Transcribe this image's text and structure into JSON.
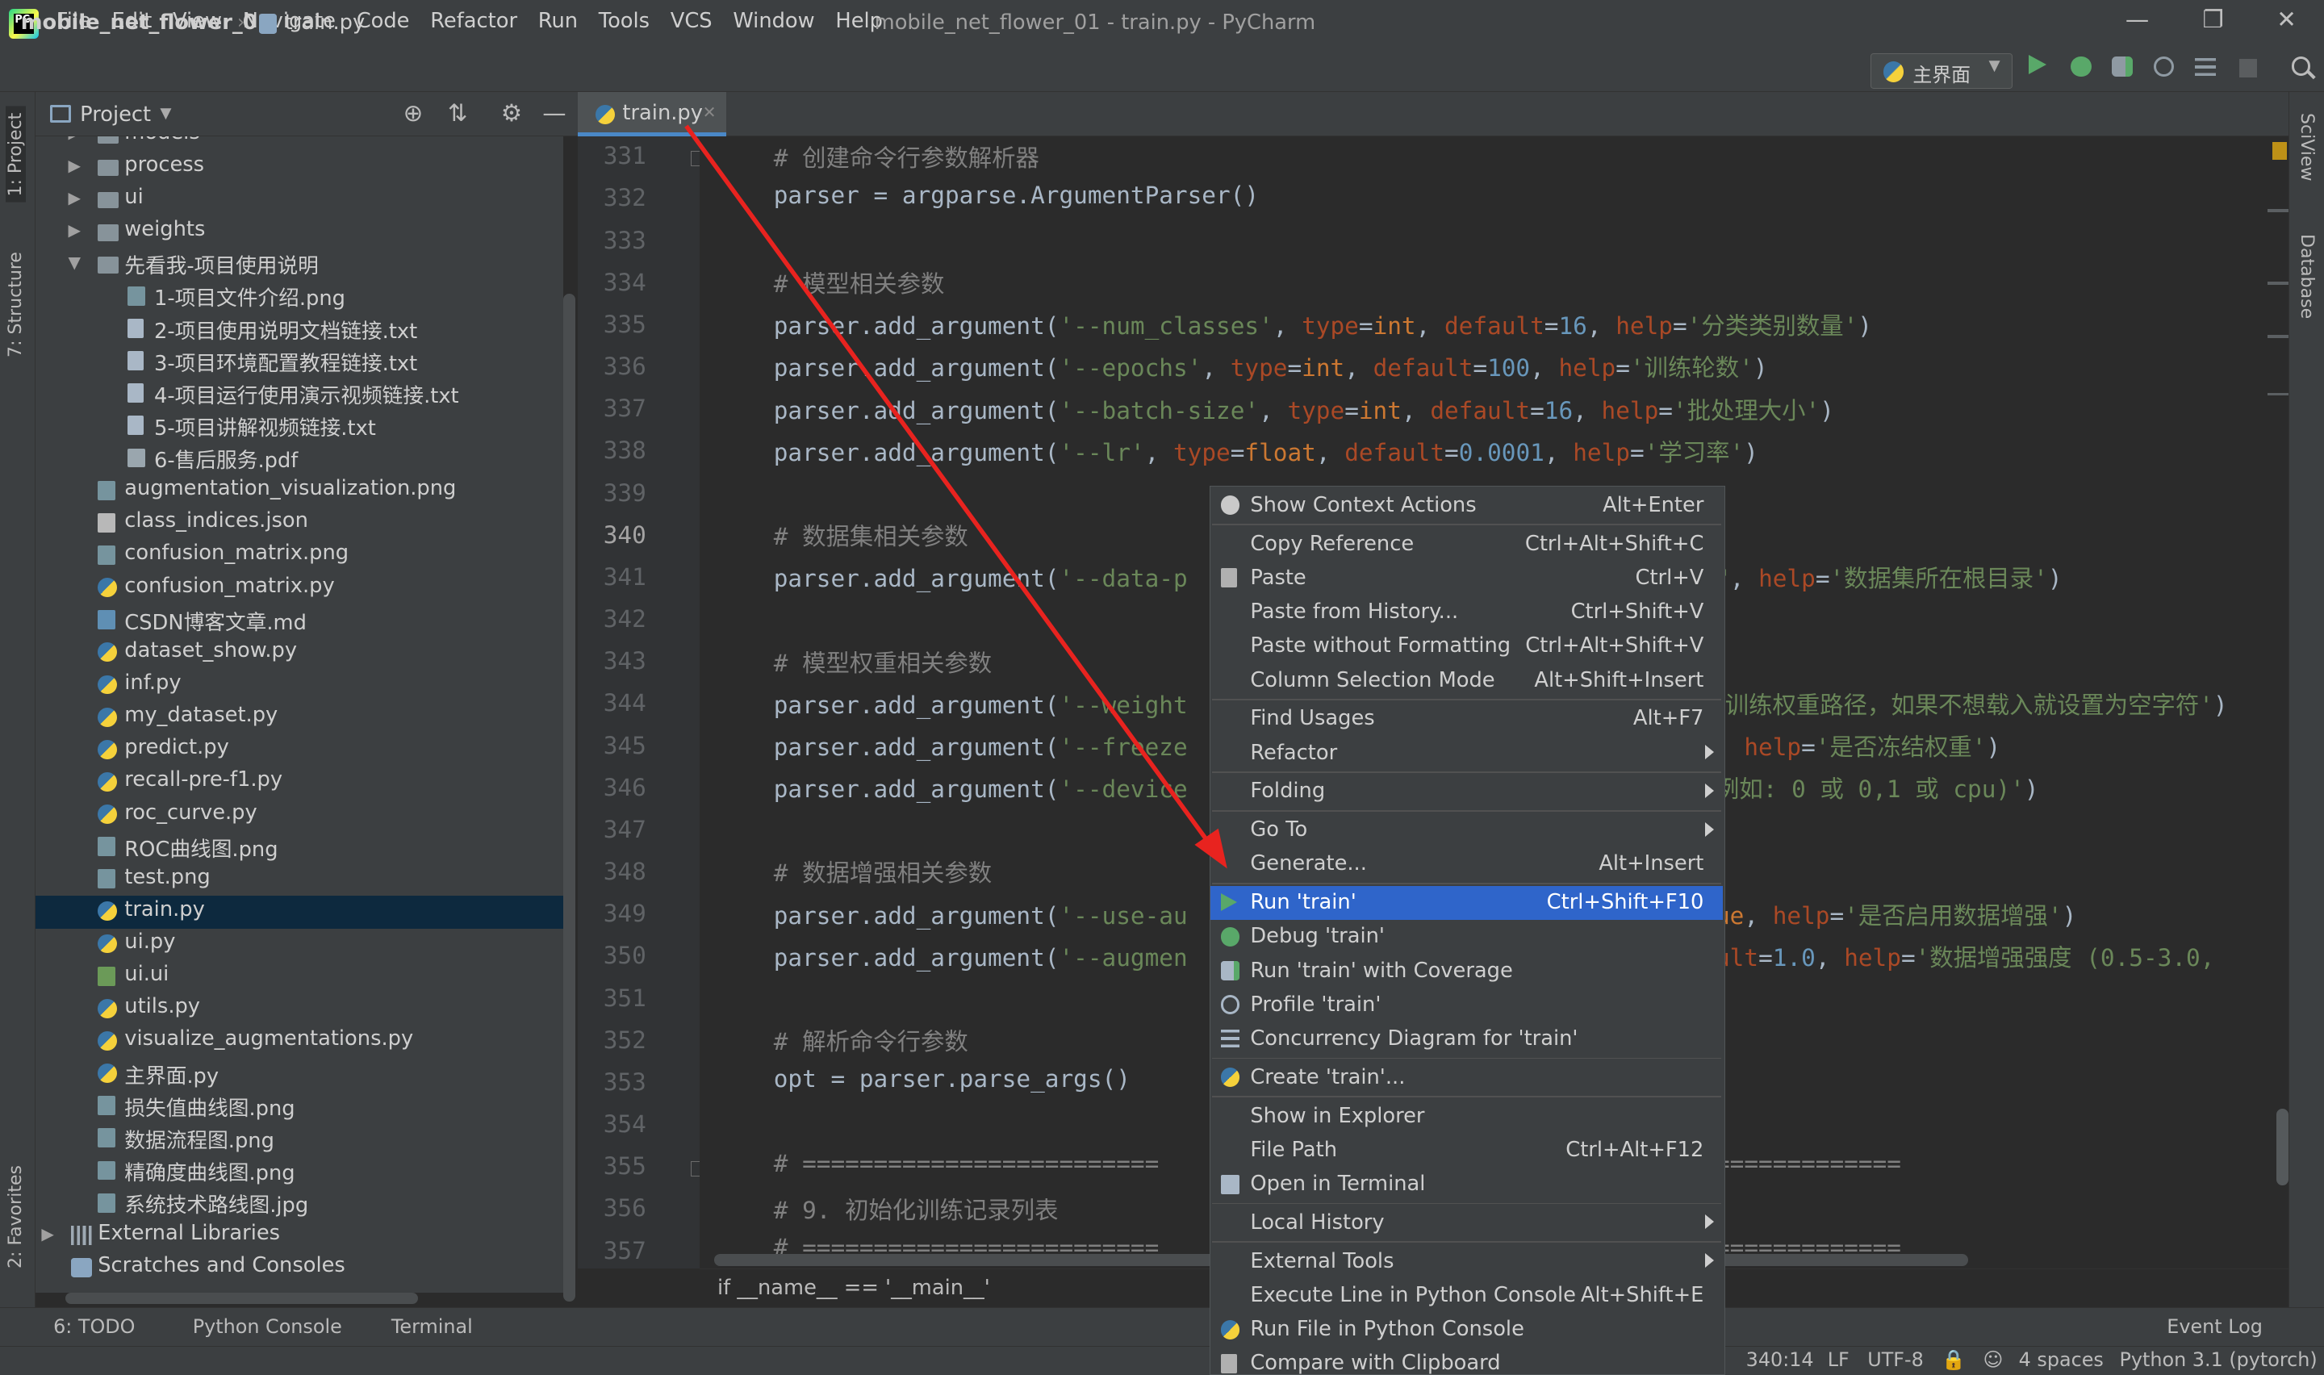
{
  "window": {
    "title": "mobile_net_flower_01 - train.py - PyCharm",
    "menu": [
      "File",
      "Edit",
      "View",
      "Navigate",
      "Code",
      "Refactor",
      "Run",
      "Tools",
      "VCS",
      "Window",
      "Help"
    ],
    "controls": {
      "minimize": "—",
      "restore": "❐",
      "close": "✕"
    }
  },
  "navbar": {
    "project": "mobile_net_flower_01",
    "file": "train.py",
    "run_config": "主界面"
  },
  "project_panel": {
    "title": "Project",
    "items": [
      {
        "label": "models",
        "type": "folder",
        "depth": 1,
        "collapsed": true
      },
      {
        "label": "process",
        "type": "folder",
        "depth": 1,
        "collapsed": true
      },
      {
        "label": "ui",
        "type": "folder",
        "depth": 1,
        "collapsed": true
      },
      {
        "label": "weights",
        "type": "folder",
        "depth": 1,
        "collapsed": true
      },
      {
        "label": "先看我-项目使用说明",
        "type": "folder",
        "depth": 1,
        "expanded": true
      },
      {
        "label": "1-项目文件介绍.png",
        "type": "img",
        "depth": 2
      },
      {
        "label": "2-项目使用说明文档链接.txt",
        "type": "file",
        "depth": 2
      },
      {
        "label": "3-项目环境配置教程链接.txt",
        "type": "file",
        "depth": 2
      },
      {
        "label": "4-项目运行使用演示视频链接.txt",
        "type": "file",
        "depth": 2
      },
      {
        "label": "5-项目讲解视频链接.txt",
        "type": "file",
        "depth": 2
      },
      {
        "label": "6-售后服务.pdf",
        "type": "pdf",
        "depth": 2
      },
      {
        "label": "augmentation_visualization.png",
        "type": "img",
        "depth": 1
      },
      {
        "label": "class_indices.json",
        "type": "json",
        "depth": 1
      },
      {
        "label": "confusion_matrix.png",
        "type": "img",
        "depth": 1
      },
      {
        "label": "confusion_matrix.py",
        "type": "py",
        "depth": 1
      },
      {
        "label": "CSDN博客文章.md",
        "type": "md",
        "depth": 1
      },
      {
        "label": "dataset_show.py",
        "type": "py",
        "depth": 1
      },
      {
        "label": "inf.py",
        "type": "py",
        "depth": 1
      },
      {
        "label": "my_dataset.py",
        "type": "py",
        "depth": 1
      },
      {
        "label": "predict.py",
        "type": "py",
        "depth": 1
      },
      {
        "label": "recall-pre-f1.py",
        "type": "py",
        "depth": 1
      },
      {
        "label": "roc_curve.py",
        "type": "py",
        "depth": 1
      },
      {
        "label": "ROC曲线图.png",
        "type": "img",
        "depth": 1
      },
      {
        "label": "test.png",
        "type": "img",
        "depth": 1
      },
      {
        "label": "train.py",
        "type": "py",
        "depth": 1,
        "selected": true
      },
      {
        "label": "ui.py",
        "type": "py",
        "depth": 1
      },
      {
        "label": "ui.ui",
        "type": "ui",
        "depth": 1
      },
      {
        "label": "utils.py",
        "type": "py",
        "depth": 1
      },
      {
        "label": "visualize_augmentations.py",
        "type": "py",
        "depth": 1
      },
      {
        "label": "主界面.py",
        "type": "py",
        "depth": 1
      },
      {
        "label": "损失值曲线图.png",
        "type": "img",
        "depth": 1
      },
      {
        "label": "数据流程图.png",
        "type": "img",
        "depth": 1
      },
      {
        "label": "精确度曲线图.png",
        "type": "img",
        "depth": 1
      },
      {
        "label": "系统技术路线图.jpg",
        "type": "img",
        "depth": 1
      },
      {
        "label": "External Libraries",
        "type": "lib",
        "depth": 0,
        "collapsed": true
      },
      {
        "label": "Scratches and Consoles",
        "type": "scratch",
        "depth": 0
      }
    ]
  },
  "left_stripe": {
    "project": "1: Project",
    "structure": "7: Structure",
    "favorites": "2: Favorites"
  },
  "right_stripe": {
    "sciview": "SciView",
    "database": "Database"
  },
  "editor": {
    "tab": "train.py",
    "current_line": "340",
    "lines": [
      {
        "n": "331",
        "t": [
          [
            "com",
            "# 创建命令行参数解析器"
          ]
        ]
      },
      {
        "n": "332",
        "t": [
          [
            "id",
            "parser = argparse.ArgumentParser()"
          ]
        ]
      },
      {
        "n": "333",
        "t": []
      },
      {
        "n": "334",
        "t": [
          [
            "com",
            "# 模型相关参数"
          ]
        ]
      },
      {
        "n": "335",
        "t": [
          [
            "id",
            "parser.add_argument("
          ],
          [
            "str",
            "'--num_classes'"
          ],
          [
            "id",
            ", "
          ],
          [
            "kw",
            "type"
          ],
          [
            "id",
            "="
          ],
          [
            "bi",
            "int"
          ],
          [
            "id",
            ", "
          ],
          [
            "kw",
            "default"
          ],
          [
            "id",
            "="
          ],
          [
            "num",
            "16"
          ],
          [
            "id",
            ", "
          ],
          [
            "kw",
            "help"
          ],
          [
            "id",
            "="
          ],
          [
            "str",
            "'分类类别数量'"
          ],
          [
            "id",
            ")"
          ]
        ]
      },
      {
        "n": "336",
        "t": [
          [
            "id",
            "parser.add_argument("
          ],
          [
            "str",
            "'--epochs'"
          ],
          [
            "id",
            ", "
          ],
          [
            "kw",
            "type"
          ],
          [
            "id",
            "="
          ],
          [
            "bi",
            "int"
          ],
          [
            "id",
            ", "
          ],
          [
            "kw",
            "default"
          ],
          [
            "id",
            "="
          ],
          [
            "num",
            "100"
          ],
          [
            "id",
            ", "
          ],
          [
            "kw",
            "help"
          ],
          [
            "id",
            "="
          ],
          [
            "str",
            "'训练轮数'"
          ],
          [
            "id",
            ")"
          ]
        ]
      },
      {
        "n": "337",
        "t": [
          [
            "id",
            "parser.add_argument("
          ],
          [
            "str",
            "'--batch-size'"
          ],
          [
            "id",
            ", "
          ],
          [
            "kw",
            "type"
          ],
          [
            "id",
            "="
          ],
          [
            "bi",
            "int"
          ],
          [
            "id",
            ", "
          ],
          [
            "kw",
            "default"
          ],
          [
            "id",
            "="
          ],
          [
            "num",
            "16"
          ],
          [
            "id",
            ", "
          ],
          [
            "kw",
            "help"
          ],
          [
            "id",
            "="
          ],
          [
            "str",
            "'批处理大小'"
          ],
          [
            "id",
            ")"
          ]
        ]
      },
      {
        "n": "338",
        "t": [
          [
            "id",
            "parser.add_argument("
          ],
          [
            "str",
            "'--lr'"
          ],
          [
            "id",
            ", "
          ],
          [
            "kw",
            "type"
          ],
          [
            "id",
            "="
          ],
          [
            "bi",
            "float"
          ],
          [
            "id",
            ", "
          ],
          [
            "kw",
            "default"
          ],
          [
            "id",
            "="
          ],
          [
            "num",
            "0.0001"
          ],
          [
            "id",
            ", "
          ],
          [
            "kw",
            "help"
          ],
          [
            "id",
            "="
          ],
          [
            "str",
            "'学习率'"
          ],
          [
            "id",
            ")"
          ]
        ]
      },
      {
        "n": "339",
        "t": []
      },
      {
        "n": "340",
        "t": [
          [
            "com",
            "# 数据集相关参数"
          ]
        ]
      },
      {
        "n": "341",
        "t": [
          [
            "id",
            "parser.add_argument("
          ],
          [
            "str",
            "'--data-p"
          ],
          [
            "pad",
            "                                     "
          ],
          [
            "str",
            "\""
          ],
          [
            "id",
            ", "
          ],
          [
            "kw",
            "help"
          ],
          [
            "id",
            "="
          ],
          [
            "str",
            "'数据集所在根目录'"
          ],
          [
            "id",
            ")"
          ]
        ]
      },
      {
        "n": "342",
        "t": []
      },
      {
        "n": "343",
        "t": [
          [
            "com",
            "# 模型权重相关参数"
          ]
        ]
      },
      {
        "n": "344",
        "t": [
          [
            "id",
            "parser.add_argument("
          ],
          [
            "str",
            "'--weight"
          ],
          [
            "pad",
            "                                    "
          ],
          [
            "str",
            "预训练权重路径，如果不想载入就设置为空字符'"
          ],
          [
            "id",
            ")"
          ]
        ]
      },
      {
        "n": "345",
        "t": [
          [
            "id",
            "parser.add_argument("
          ],
          [
            "str",
            "'--freeze"
          ],
          [
            "pad",
            "                                    "
          ],
          [
            "bi",
            "e"
          ],
          [
            "id",
            ", "
          ],
          [
            "kw",
            "help"
          ],
          [
            "id",
            "="
          ],
          [
            "str",
            "'是否冻结权重'"
          ],
          [
            "id",
            ")"
          ]
        ]
      },
      {
        "n": "346",
        "t": [
          [
            "id",
            "parser.add_argument("
          ],
          [
            "str",
            "'--device"
          ],
          [
            "pad",
            "                                    "
          ],
          [
            "str",
            "(例如: 0 或 0,1 或 cpu)'"
          ],
          [
            "id",
            ")"
          ]
        ]
      },
      {
        "n": "347",
        "t": []
      },
      {
        "n": "348",
        "t": [
          [
            "com",
            "# 数据增强相关参数"
          ]
        ]
      },
      {
        "n": "349",
        "t": [
          [
            "id",
            "parser.add_argument("
          ],
          [
            "str",
            "'--use-au"
          ],
          [
            "pad",
            "                                    "
          ],
          [
            "bi",
            "rue"
          ],
          [
            "id",
            ", "
          ],
          [
            "kw",
            "help"
          ],
          [
            "id",
            "="
          ],
          [
            "str",
            "'是否启用数据增强'"
          ],
          [
            "id",
            ")"
          ]
        ]
      },
      {
        "n": "350",
        "t": [
          [
            "id",
            "parser.add_argument("
          ],
          [
            "str",
            "'--augmen"
          ],
          [
            "pad",
            "                                    "
          ],
          [
            "kw",
            "ault"
          ],
          [
            "id",
            "="
          ],
          [
            "num",
            "1.0"
          ],
          [
            "id",
            ", "
          ],
          [
            "kw",
            "help"
          ],
          [
            "id",
            "="
          ],
          [
            "str",
            "'数据增强强度 (0.5-3.0,"
          ]
        ]
      },
      {
        "n": "351",
        "t": []
      },
      {
        "n": "352",
        "t": [
          [
            "com",
            "# 解析命令行参数"
          ]
        ]
      },
      {
        "n": "353",
        "t": [
          [
            "id",
            "opt = parser.parse_args()"
          ]
        ]
      },
      {
        "n": "354",
        "t": []
      },
      {
        "n": "355",
        "t": [
          [
            "com",
            "# ========================="
          ],
          [
            "pad",
            "                                 "
          ],
          [
            "com",
            "==================="
          ]
        ]
      },
      {
        "n": "356",
        "t": [
          [
            "com",
            "# 9. 初始化训练记录列表"
          ]
        ]
      },
      {
        "n": "357",
        "t": [
          [
            "com",
            "# ========================="
          ],
          [
            "pad",
            "                                 "
          ],
          [
            "com",
            "==================="
          ]
        ]
      }
    ],
    "breadcrumb": "if __name__ == '__main__'"
  },
  "context_menu": {
    "items": [
      {
        "label": "Show Context Actions",
        "shortcut": "Alt+Enter",
        "icon": "bulb"
      },
      {
        "sep": true
      },
      {
        "label": "Copy Reference",
        "shortcut": "Ctrl+Alt+Shift+C"
      },
      {
        "label": "Paste",
        "shortcut": "Ctrl+V",
        "icon": "paste"
      },
      {
        "label": "Paste from History...",
        "shortcut": "Ctrl+Shift+V"
      },
      {
        "label": "Paste without Formatting",
        "shortcut": "Ctrl+Alt+Shift+V"
      },
      {
        "label": "Column Selection Mode",
        "shortcut": "Alt+Shift+Insert"
      },
      {
        "sep": true
      },
      {
        "label": "Find Usages",
        "shortcut": "Alt+F7"
      },
      {
        "label": "Refactor",
        "submenu": true
      },
      {
        "sep": true
      },
      {
        "label": "Folding",
        "submenu": true
      },
      {
        "sep": true
      },
      {
        "label": "Go To",
        "submenu": true
      },
      {
        "label": "Generate...",
        "shortcut": "Alt+Insert"
      },
      {
        "sep": true
      },
      {
        "label": "Run 'train'",
        "shortcut": "Ctrl+Shift+F10",
        "icon": "play",
        "selected": true
      },
      {
        "label": "Debug 'train'",
        "icon": "bug"
      },
      {
        "label": "Run 'train' with Coverage",
        "icon": "cov"
      },
      {
        "label": "Profile 'train'",
        "icon": "prof"
      },
      {
        "label": "Concurrency Diagram for 'train'",
        "icon": "conc"
      },
      {
        "sep": true
      },
      {
        "label": "Create 'train'...",
        "icon": "pycre"
      },
      {
        "sep": true
      },
      {
        "label": "Show in Explorer"
      },
      {
        "label": "File Path",
        "shortcut": "Ctrl+Alt+F12"
      },
      {
        "label": "Open in Terminal",
        "icon": "term"
      },
      {
        "sep": true
      },
      {
        "label": "Local History",
        "submenu": true
      },
      {
        "sep": true
      },
      {
        "label": "External Tools",
        "submenu": true
      },
      {
        "label": "Execute Line in Python Console",
        "shortcut": "Alt+Shift+E"
      },
      {
        "label": "Run File in Python Console",
        "icon": "pycre"
      },
      {
        "label": "Compare with Clipboard",
        "icon": "paste"
      }
    ]
  },
  "tool_tabs": {
    "todo": "6: TODO",
    "console": "Python Console",
    "terminal": "Terminal",
    "event_log": "Event Log"
  },
  "status": {
    "position": "340:14",
    "line_sep": "LF",
    "encoding": "UTF-8",
    "indent": "4 spaces",
    "interpreter": "Python 3.1 (pytorch)"
  },
  "colors": {
    "accent": "#2f65ca",
    "arrow": "#e8231f",
    "run": "#59a869"
  }
}
